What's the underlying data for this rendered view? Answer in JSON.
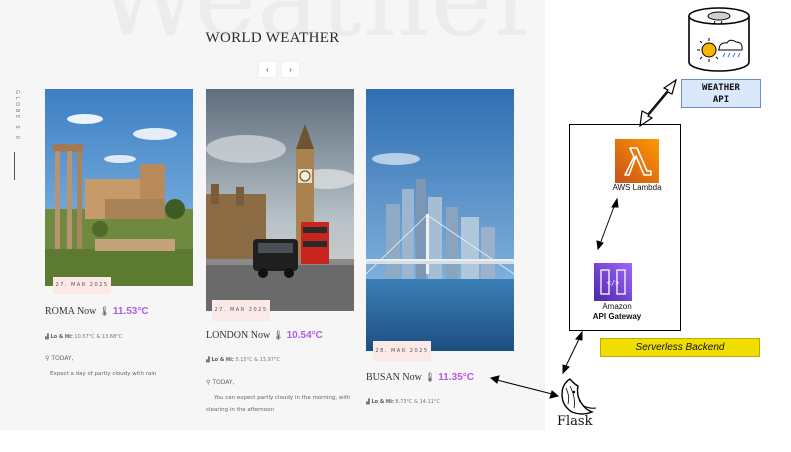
{
  "app": {
    "background_word": "Weather",
    "title": "WORLD WEATHER",
    "nav": {
      "prev_icon": "‹",
      "next_icon": "›"
    },
    "vertical_label": "GLOBE 0 0",
    "cards": [
      {
        "date": "27. MAR 2025",
        "city": "ROMA Now",
        "thermometer_icon": "🌡",
        "temp": "11.53°C",
        "lohi_label": "Lo & Hi:",
        "lohi_value": "10.57°C & 13.68°C",
        "today_label": "TODAY,",
        "description": "Expect a day of partly cloudy with rain"
      },
      {
        "date": "27. MAR 2025",
        "city": "LONDON Now",
        "thermometer_icon": "🌡",
        "temp": "10.54°C",
        "lohi_label": "Lo & Hi:",
        "lohi_value": "5.15°C & 13.97°C",
        "today_label": "TODAY,",
        "description": "You can expect partly cloudy in the morning, with clearing in the afternoon"
      },
      {
        "date": "28. MAR 2025",
        "city": "BUSAN Now",
        "thermometer_icon": "🌡",
        "temp": "11.35°C",
        "lohi_label": "Lo & Hi:",
        "lohi_value": "8.73°C & 14.11°C"
      }
    ]
  },
  "diagram": {
    "weather_api": {
      "line1": "WEATHER",
      "line2": "API"
    },
    "lambda_label": "AWS Lambda",
    "gateway_label_1": "Amazon",
    "gateway_label_2": "API Gateway",
    "serverless_label": "Serverless Backend",
    "flask_label": "Flask",
    "colors": {
      "lambda": "#ed7100",
      "gateway": "#8c4fff",
      "api_box": "#dae8fc",
      "backend_label": "#f0de00",
      "temp_accent": "#b35be6"
    }
  }
}
